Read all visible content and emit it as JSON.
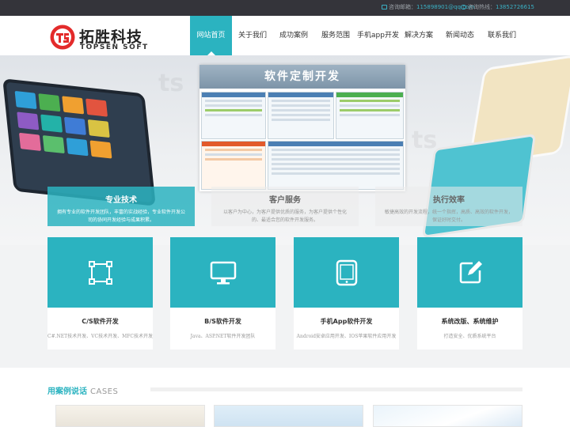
{
  "topbar": {
    "email_label": "咨询邮箱：",
    "email_value": "115898901@qq.com",
    "phone_label": "咨询热线：",
    "phone_value": "13852726615"
  },
  "logo": {
    "name_cn": "拓胜科技",
    "name_en": "TOPSEN SOFT",
    "brand_color": "#e32b2b"
  },
  "nav": {
    "items": [
      {
        "label": "网站首页",
        "active": true
      },
      {
        "label": "关于我们"
      },
      {
        "label": "成功案例"
      },
      {
        "label": "服务范围"
      },
      {
        "label": "手机app开发"
      },
      {
        "label": "解决方案"
      },
      {
        "label": "新闻动态"
      },
      {
        "label": "联系我们"
      }
    ]
  },
  "banner": {
    "title": "软件定制开发"
  },
  "features": [
    {
      "title": "专业技术",
      "desc": "拥有专业的软件开发团队，丰富的实战经验，专业软件开发公司的协同开发经验与成果积累。"
    },
    {
      "title": "客户服务",
      "desc": "以客户为中心，为客户提供优质的服务，为客户提供个性化的、最适合您的软件开发服务。"
    },
    {
      "title": "执行效率",
      "desc": "敏捷高效的开发流程，统一个指挥，高质、高效的软件开发，保证好时交付。"
    }
  ],
  "services": [
    {
      "title": "C/S软件开发",
      "desc": "C#.NET技术开发、VC技术开发、MFC技术开发",
      "icon": "select-frame-icon"
    },
    {
      "title": "B/S软件开发",
      "desc": "Java、ASP.NET软件开发团队",
      "icon": "monitor-icon"
    },
    {
      "title": "手机App软件开发",
      "desc": "Android安卓应用开发、IOS苹果软件应用开发",
      "icon": "tablet-icon"
    },
    {
      "title": "系统改版、系统维护",
      "desc": "打造安全、优质系统平台",
      "icon": "edit-icon"
    }
  ],
  "cases": {
    "title": "用案例说话",
    "subtitle": "CASES"
  },
  "colors": {
    "accent": "#2bb3c0",
    "topbar_bg": "#34343a",
    "brand_red": "#e32b2b"
  }
}
